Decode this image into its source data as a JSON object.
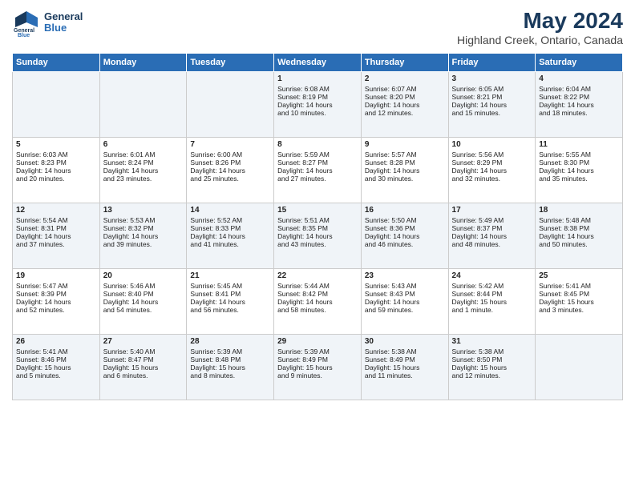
{
  "logo": {
    "line1": "General",
    "line2": "Blue"
  },
  "title": "May 2024",
  "subtitle": "Highland Creek, Ontario, Canada",
  "headers": [
    "Sunday",
    "Monday",
    "Tuesday",
    "Wednesday",
    "Thursday",
    "Friday",
    "Saturday"
  ],
  "weeks": [
    [
      {
        "day": "",
        "content": ""
      },
      {
        "day": "",
        "content": ""
      },
      {
        "day": "",
        "content": ""
      },
      {
        "day": "1",
        "content": "Sunrise: 6:08 AM\nSunset: 8:19 PM\nDaylight: 14 hours\nand 10 minutes."
      },
      {
        "day": "2",
        "content": "Sunrise: 6:07 AM\nSunset: 8:20 PM\nDaylight: 14 hours\nand 12 minutes."
      },
      {
        "day": "3",
        "content": "Sunrise: 6:05 AM\nSunset: 8:21 PM\nDaylight: 14 hours\nand 15 minutes."
      },
      {
        "day": "4",
        "content": "Sunrise: 6:04 AM\nSunset: 8:22 PM\nDaylight: 14 hours\nand 18 minutes."
      }
    ],
    [
      {
        "day": "5",
        "content": "Sunrise: 6:03 AM\nSunset: 8:23 PM\nDaylight: 14 hours\nand 20 minutes."
      },
      {
        "day": "6",
        "content": "Sunrise: 6:01 AM\nSunset: 8:24 PM\nDaylight: 14 hours\nand 23 minutes."
      },
      {
        "day": "7",
        "content": "Sunrise: 6:00 AM\nSunset: 8:26 PM\nDaylight: 14 hours\nand 25 minutes."
      },
      {
        "day": "8",
        "content": "Sunrise: 5:59 AM\nSunset: 8:27 PM\nDaylight: 14 hours\nand 27 minutes."
      },
      {
        "day": "9",
        "content": "Sunrise: 5:57 AM\nSunset: 8:28 PM\nDaylight: 14 hours\nand 30 minutes."
      },
      {
        "day": "10",
        "content": "Sunrise: 5:56 AM\nSunset: 8:29 PM\nDaylight: 14 hours\nand 32 minutes."
      },
      {
        "day": "11",
        "content": "Sunrise: 5:55 AM\nSunset: 8:30 PM\nDaylight: 14 hours\nand 35 minutes."
      }
    ],
    [
      {
        "day": "12",
        "content": "Sunrise: 5:54 AM\nSunset: 8:31 PM\nDaylight: 14 hours\nand 37 minutes."
      },
      {
        "day": "13",
        "content": "Sunrise: 5:53 AM\nSunset: 8:32 PM\nDaylight: 14 hours\nand 39 minutes."
      },
      {
        "day": "14",
        "content": "Sunrise: 5:52 AM\nSunset: 8:33 PM\nDaylight: 14 hours\nand 41 minutes."
      },
      {
        "day": "15",
        "content": "Sunrise: 5:51 AM\nSunset: 8:35 PM\nDaylight: 14 hours\nand 43 minutes."
      },
      {
        "day": "16",
        "content": "Sunrise: 5:50 AM\nSunset: 8:36 PM\nDaylight: 14 hours\nand 46 minutes."
      },
      {
        "day": "17",
        "content": "Sunrise: 5:49 AM\nSunset: 8:37 PM\nDaylight: 14 hours\nand 48 minutes."
      },
      {
        "day": "18",
        "content": "Sunrise: 5:48 AM\nSunset: 8:38 PM\nDaylight: 14 hours\nand 50 minutes."
      }
    ],
    [
      {
        "day": "19",
        "content": "Sunrise: 5:47 AM\nSunset: 8:39 PM\nDaylight: 14 hours\nand 52 minutes."
      },
      {
        "day": "20",
        "content": "Sunrise: 5:46 AM\nSunset: 8:40 PM\nDaylight: 14 hours\nand 54 minutes."
      },
      {
        "day": "21",
        "content": "Sunrise: 5:45 AM\nSunset: 8:41 PM\nDaylight: 14 hours\nand 56 minutes."
      },
      {
        "day": "22",
        "content": "Sunrise: 5:44 AM\nSunset: 8:42 PM\nDaylight: 14 hours\nand 58 minutes."
      },
      {
        "day": "23",
        "content": "Sunrise: 5:43 AM\nSunset: 8:43 PM\nDaylight: 14 hours\nand 59 minutes."
      },
      {
        "day": "24",
        "content": "Sunrise: 5:42 AM\nSunset: 8:44 PM\nDaylight: 15 hours\nand 1 minute."
      },
      {
        "day": "25",
        "content": "Sunrise: 5:41 AM\nSunset: 8:45 PM\nDaylight: 15 hours\nand 3 minutes."
      }
    ],
    [
      {
        "day": "26",
        "content": "Sunrise: 5:41 AM\nSunset: 8:46 PM\nDaylight: 15 hours\nand 5 minutes."
      },
      {
        "day": "27",
        "content": "Sunrise: 5:40 AM\nSunset: 8:47 PM\nDaylight: 15 hours\nand 6 minutes."
      },
      {
        "day": "28",
        "content": "Sunrise: 5:39 AM\nSunset: 8:48 PM\nDaylight: 15 hours\nand 8 minutes."
      },
      {
        "day": "29",
        "content": "Sunrise: 5:39 AM\nSunset: 8:49 PM\nDaylight: 15 hours\nand 9 minutes."
      },
      {
        "day": "30",
        "content": "Sunrise: 5:38 AM\nSunset: 8:49 PM\nDaylight: 15 hours\nand 11 minutes."
      },
      {
        "day": "31",
        "content": "Sunrise: 5:38 AM\nSunset: 8:50 PM\nDaylight: 15 hours\nand 12 minutes."
      },
      {
        "day": "",
        "content": ""
      }
    ]
  ]
}
